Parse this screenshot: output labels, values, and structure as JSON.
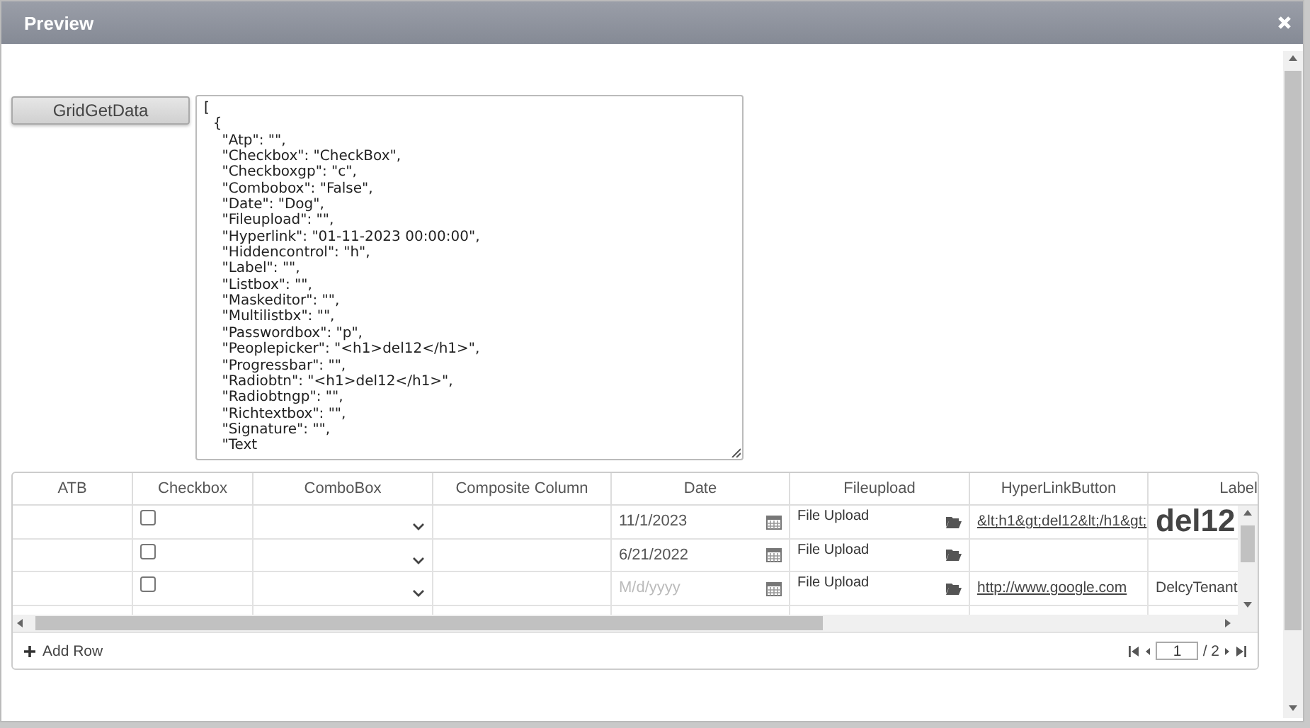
{
  "window": {
    "title": "Preview"
  },
  "get_data_button": "GridGetData",
  "json_output": {
    "lines": [
      "[",
      "  {",
      "    \"Atp\": \"\",",
      "    \"Checkbox\": \"CheckBox\",",
      "    \"Checkboxgp\": \"c\",",
      "    \"Combobox\": \"False\",",
      "    \"Date\": \"Dog\",",
      "    \"Fileupload\": \"\",",
      "    \"Hyperlink\": \"01-11-2023 00:00:00\",",
      "    \"Hiddencontrol\": \"h\",",
      "    \"Label\": \"\",",
      "    \"Listbox\": \"\",",
      "    \"Maskeditor\": \"\",",
      "    \"Multilistbx\": \"\",",
      "    \"Passwordbox\": \"p\",",
      "    \"Peoplepicker\": \"<h1>del12</h1>\",",
      "    \"Progressbar\": \"\",",
      "    \"Radiobtn\": \"<h1>del12</h1>\",",
      "    \"Radiobtngp\": \"\",",
      "    \"Richtextbox\": \"\",",
      "    \"Signature\": \"\",",
      "    \"Text"
    ]
  },
  "grid": {
    "columns": [
      "ATB",
      "Checkbox",
      "ComboBox",
      "Composite Column",
      "Date",
      "Fileupload",
      "HyperLinkButton",
      "Label"
    ],
    "rows": [
      {
        "checked": false,
        "date": "11/1/2023",
        "file": "File Upload",
        "link": "&lt;h1&gt;del12&lt;/h1&gt;",
        "label": {
          "kind": "heading",
          "text": "del12"
        }
      },
      {
        "checked": false,
        "date": "6/21/2022",
        "file": "File Upload"
      },
      {
        "checked": false,
        "date_placeholder": "M/d/yyyy",
        "file": "File Upload",
        "link": "http://www.google.com",
        "label": {
          "kind": "plain",
          "text": "DelcyTenant"
        }
      },
      {}
    ],
    "add_row": "Add Row",
    "pager": {
      "page": "1",
      "total": "/ 2"
    }
  }
}
